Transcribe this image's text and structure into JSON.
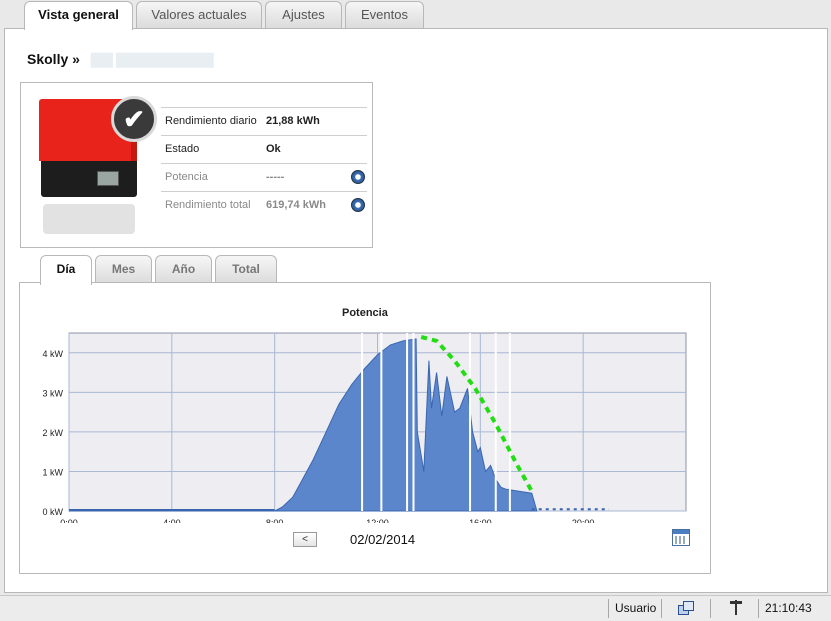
{
  "top_tabs": [
    {
      "label": "Vista general",
      "active": true
    },
    {
      "label": "Valores actuales",
      "active": false
    },
    {
      "label": "Ajustes",
      "active": false
    },
    {
      "label": "Eventos",
      "active": false
    }
  ],
  "breadcrumb": {
    "device": "Skolly »"
  },
  "device": {
    "status_icon": "check-icon",
    "rows": [
      {
        "label": "Rendimiento diario",
        "value": "21,88  kWh",
        "dim": false,
        "icon": null
      },
      {
        "label": "Estado",
        "value": "Ok",
        "dim": false,
        "icon": null
      },
      {
        "label": "Potencia",
        "value": "-----",
        "dim": true,
        "icon": "stopwatch-icon"
      },
      {
        "label": "Rendimiento total",
        "value": "619,74  kWh",
        "dim": true,
        "icon": "stopwatch-icon"
      }
    ]
  },
  "chart_tabs": [
    {
      "label": "Día",
      "active": true
    },
    {
      "label": "Mes",
      "active": false
    },
    {
      "label": "Año",
      "active": false
    },
    {
      "label": "Total",
      "active": false
    }
  ],
  "chart_nav": {
    "prev_symbol": "<",
    "date": "02/02/2014"
  },
  "chart_data": {
    "type": "area",
    "title": "Potencia",
    "xlabel": "",
    "ylabel": "",
    "x_ticks": [
      "0:00",
      "4:00",
      "8:00",
      "12:00",
      "16:00",
      "20:00"
    ],
    "y_ticks": [
      "0 kW",
      "1 kW",
      "2 kW",
      "3 kW",
      "4 kW"
    ],
    "xlim": [
      0,
      24
    ],
    "ylim": [
      0,
      4.5
    ],
    "grid": true,
    "colors": {
      "area": "#5b86cc",
      "area_line": "#3a66b0",
      "forecast": "#22dd11",
      "plot_bg": "#ededf2",
      "grid": "#aab8d4"
    },
    "series": [
      {
        "kind": "area",
        "x": [
          0,
          8.0,
          8.3,
          8.7,
          9.0,
          9.5,
          10.0,
          10.5,
          11.0,
          11.5,
          12.0,
          12.5,
          13.0,
          13.5,
          13.55,
          13.8,
          14.0,
          14.1,
          14.3,
          14.5,
          14.7,
          15.0,
          15.2,
          15.5,
          15.7,
          15.9,
          16.0,
          16.2,
          16.4,
          16.6,
          16.8,
          17.0,
          17.5,
          18.0,
          18.2
        ],
        "y": [
          0,
          0,
          0.1,
          0.35,
          0.7,
          1.3,
          2.0,
          2.7,
          3.2,
          3.6,
          3.95,
          4.2,
          4.3,
          4.35,
          2.0,
          1.0,
          3.8,
          2.6,
          3.5,
          2.4,
          3.4,
          2.5,
          2.6,
          3.1,
          2.0,
          1.5,
          1.6,
          1.0,
          1.15,
          0.8,
          0.6,
          0.55,
          0.5,
          0.45,
          0.0
        ]
      }
    ],
    "forecast": {
      "kind": "dashed-line",
      "x": [
        13.7,
        14.3,
        15.0,
        15.8,
        16.6,
        17.4,
        18.0
      ],
      "y": [
        4.4,
        4.3,
        3.8,
        3.1,
        2.2,
        1.2,
        0.5
      ]
    },
    "dotted_tail": {
      "x": [
        18.0,
        21.0
      ],
      "y": [
        0.02,
        0.02
      ]
    }
  },
  "status_bar": {
    "user": "Usuario",
    "time": "21:10:43",
    "icons": [
      "network-icon",
      "signal-icon"
    ]
  }
}
